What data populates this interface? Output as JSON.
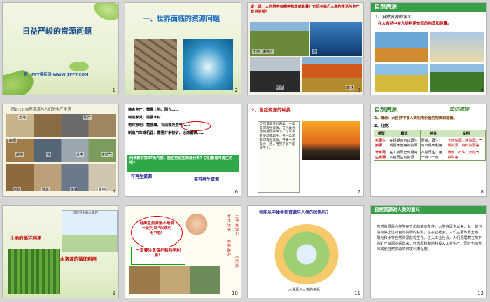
{
  "slides": [
    {
      "num": "1",
      "title": "日益严峻的资源问题",
      "subtitle": "第一PPT模板网-WWW.1PPT.COM"
    },
    {
      "num": "2",
      "title": "一、世界面临的资源问题"
    },
    {
      "num": "3",
      "question": "说一说：大自然中有哪些物质或能量？它们与我们人类的生活与生产有何关系？",
      "labels": [
        "土地（耕地）",
        "水",
        "矿产",
        "森林"
      ]
    },
    {
      "num": "4",
      "header": "自然资源",
      "point1": "1、自然资源的含义",
      "definition": "在大自然中被人类利用价值的物质和能量。"
    },
    {
      "num": "5",
      "caption": "图8-12 自然资源与人们的生产生活",
      "photo_labels": [
        "土地",
        "矿产",
        "能源",
        "耕地",
        "铁",
        "发电",
        "天然气",
        "木材",
        "建筑",
        "炼钢",
        "发电"
      ]
    },
    {
      "num": "6",
      "lines": [
        "粮食生产：需要土地、阳光……",
        "制造家具：需要木材……",
        "电灯照明：需要煤、石油或天然气……",
        "制造汽车或机器：需要开采铁矿、冶炼钢铁……"
      ],
      "note": "阅读教材第97页内容，能否把这些资源分类？它们都是可再生的吗？",
      "renew": "可再生资源",
      "nonrenew": "非可再生资源"
    },
    {
      "num": "7",
      "header": "2、自然资源的种类",
      "body": "自然资源分为两类：一类是可再生资源，在人类合理利用的条件下，可以不断更新或再生；另一类是非可再生资源，开采一点就少一点，用完了就不能再生了。"
    },
    {
      "num": "8",
      "header": "自然资源",
      "badge": "知识梳理",
      "point1": "1、概念：大自然中被人类利用价值的物质和能量。",
      "point2": "2、分类：",
      "table_head": [
        "类型",
        "概念",
        "特征",
        "举例"
      ],
      "rows": [
        [
          "可再生资源",
          "在短期内可以再生或循环使用的资源",
          "更新、再生；可以循环利用",
          "土地资源、水资源、气候资源、森林资源等"
        ],
        [
          "非可再生资源",
          "在人类历史时期内不能再生的资源",
          "不能再生；用一点少一点",
          "煤炭、石油、天然气、铁矿等"
        ]
      ]
    },
    {
      "num": "9",
      "diagram_title": "自然界中的水循环",
      "land": "土地的循环利用",
      "water": "水资源的循环利用"
    },
    {
      "num": "10",
      "bubble": "可再生资源是不是就一定可以“永续利用”呢？",
      "slogan": "一定要注意保护和科学利用！",
      "side": [
        "水土流失",
        "森林破坏",
        "土地荒漠化",
        "水污染"
      ]
    },
    {
      "num": "11",
      "question": "你能从中体会到资源与人类的关系吗？",
      "caption": "水资源与人类的关系"
    },
    {
      "num": "12",
      "header": "自然资源对人类的意义",
      "body": "自然资源是人类生存立命的基本条件。人类自诞生以来，就一刻也没有停止过对自然资源的获取。在农业社会，人们主要依靠土地、阳光和水等自然资源获得生存。进入工业社会，人们把埋藏在地下的矿产资源挖掘出来，作为原料和燃料投入工业生产。同时也加大对其他自然资源的开发利用程度。"
    }
  ]
}
